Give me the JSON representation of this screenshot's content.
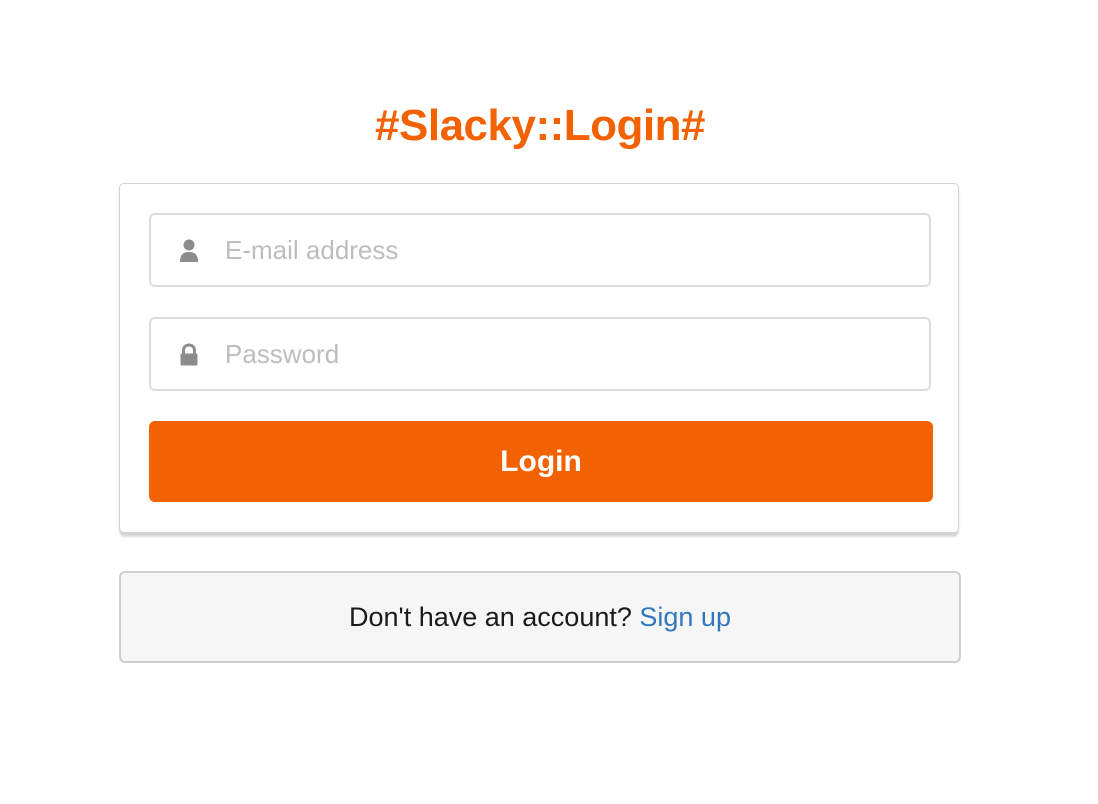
{
  "header": {
    "title": "#Slacky::Login#"
  },
  "login_form": {
    "email": {
      "placeholder": "E-mail address",
      "value": "",
      "icon": "user-icon"
    },
    "password": {
      "placeholder": "Password",
      "value": "",
      "icon": "lock-icon"
    },
    "submit_label": "Login"
  },
  "signup": {
    "prompt": "Don't have an account?",
    "link_label": "Sign up"
  },
  "colors": {
    "accent": "#f26202",
    "link": "#3277bd",
    "icon": "#8c8c8c",
    "placeholder": "#bdbdbd"
  }
}
